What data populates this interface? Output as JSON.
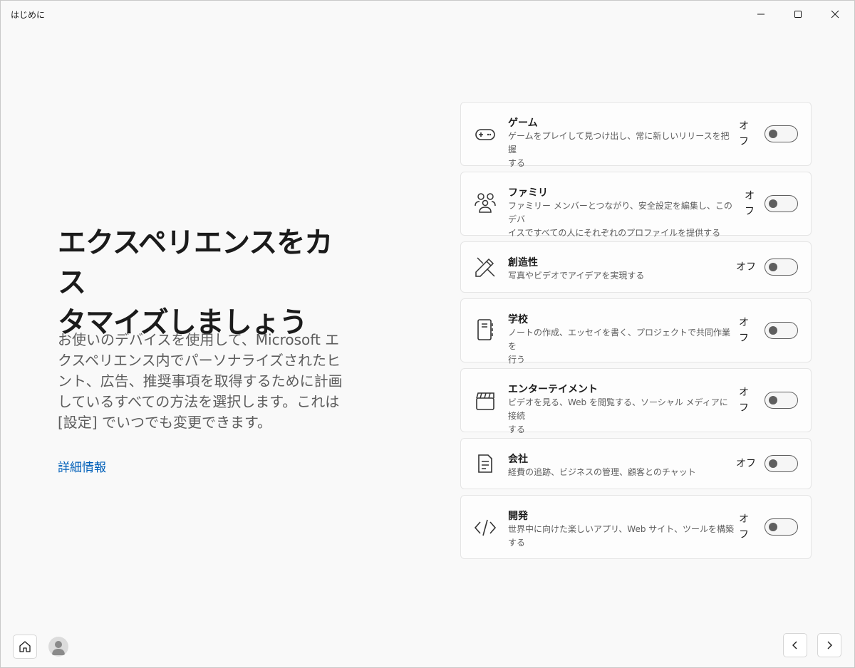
{
  "window": {
    "title": "はじめに"
  },
  "main": {
    "heading_line1": "エクスペリエンスをカス",
    "heading_line2": "タマイズしましょう",
    "description": "お使いのデバイスを使用して、Microsoft エクスペリエンス内でパーソナライズされたヒント、広告、推奨事項を取得するために計画しているすべての方法を選択します。これは [設定] でいつでも変更できます。",
    "more_info_link": "詳細情報"
  },
  "cards": [
    {
      "title": "ゲーム",
      "subtitle_line1": "ゲームをプレイして見つけ出し、常に新しいリリースを把握",
      "subtitle_line2": "する",
      "state": "オフ",
      "icon": "gamepad-icon",
      "on": false
    },
    {
      "title": "ファミリ",
      "subtitle_line1": "ファミリー メンバーとつながり、安全設定を編集し、このデバ",
      "subtitle_line2": "イスですべての人にそれぞれのプロファイルを提供する",
      "state": "オフ",
      "icon": "family-icon",
      "on": false
    },
    {
      "title": "創造性",
      "subtitle_line1": "写真やビデオでアイデアを実現する",
      "subtitle_line2": "",
      "state": "オフ",
      "icon": "paintbrush-icon",
      "on": false
    },
    {
      "title": "学校",
      "subtitle_line1": "ノートの作成、エッセイを書く、プロジェクトで共同作業を",
      "subtitle_line2": "行う",
      "state": "オフ",
      "icon": "notebook-icon",
      "on": false
    },
    {
      "title": "エンターテイメント",
      "subtitle_line1": "ビデオを見る、Web を閲覧する、ソーシャル メディアに接続",
      "subtitle_line2": "する",
      "state": "オフ",
      "icon": "clapperboard-icon",
      "on": false
    },
    {
      "title": "会社",
      "subtitle_line1": "経費の追跡、ビジネスの管理、顧客とのチャット",
      "subtitle_line2": "",
      "state": "オフ",
      "icon": "document-icon",
      "on": false
    },
    {
      "title": "開発",
      "subtitle_line1": "世界中に向けた楽しいアプリ、Web サイト、ツールを構築",
      "subtitle_line2": "する",
      "state": "オフ",
      "icon": "code-icon",
      "on": false
    }
  ],
  "colors": {
    "accent": "#005fb8",
    "background": "#f9f9f9",
    "card": "#fdfdfd"
  }
}
